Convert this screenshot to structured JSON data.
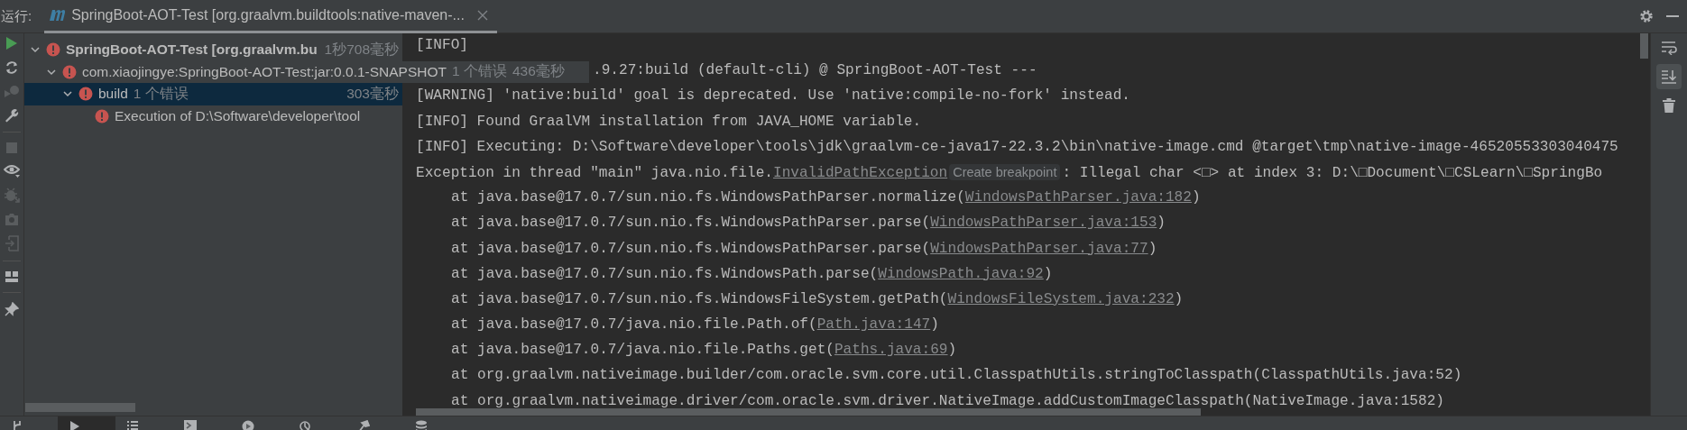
{
  "header": {
    "label": "运行:",
    "tab": {
      "title": "SpringBoot-AOT-Test [org.graalvm.buildtools:native-maven-...",
      "selected": true
    }
  },
  "tree": [
    {
      "name": "SpringBoot-AOT-Test [org.graalvm.bu",
      "bold": true,
      "time": "1秒708毫秒",
      "expanded": true,
      "selected": false,
      "children": [
        {
          "name": "com.xiaojingye:SpringBoot-AOT-Test:jar:0.0.1-SNAPSHOT",
          "bold": false,
          "errors": "1 个错误",
          "time": "436毫秒",
          "expanded": true,
          "selected": false,
          "children": [
            {
              "name": "build",
              "bold": false,
              "errors": "1 个错误",
              "time": "303毫秒",
              "expanded": true,
              "selected": true,
              "children": [
                {
                  "name": "Execution of D:\\Software\\developer\\tool",
                  "bold": false,
                  "selected": false
                }
              ]
            }
          ]
        }
      ]
    }
  ],
  "console": [
    {
      "kind": "message",
      "segments": [
        {
          "kind": "plain",
          "text": "[INFO]"
        }
      ]
    },
    {
      "kind": "continued",
      "segments": [
        {
          "kind": "plain",
          "text": ".9.27:build (default-cli) @ SpringBoot-AOT-Test ---"
        }
      ]
    },
    {
      "kind": "message",
      "segments": [
        {
          "kind": "plain",
          "text": "[WARNING] 'native:build' goal is deprecated. Use 'native:compile-no-fork' instead."
        }
      ]
    },
    {
      "kind": "message",
      "segments": [
        {
          "kind": "plain",
          "text": "[INFO] Found GraalVM installation from JAVA_HOME variable."
        }
      ]
    },
    {
      "kind": "message",
      "segments": [
        {
          "kind": "plain",
          "text": "[INFO] Executing: D:\\Software\\developer\\tools\\jdk\\graalvm-ce-java17-22.3.2\\bin\\native-image.cmd @target\\tmp\\native-image-46520553303040475"
        }
      ]
    },
    {
      "kind": "message",
      "segments": [
        {
          "kind": "plain",
          "text": "Exception in thread \"main\" java.nio.file."
        },
        {
          "kind": "link",
          "text": "InvalidPathException"
        },
        {
          "kind": "hint",
          "text": "Create breakpoint"
        },
        {
          "kind": "plain",
          "text": ": Illegal char <□> at index 3: D:\\□Document\\□CSLearn\\□SpringBo"
        }
      ]
    },
    {
      "kind": "frame",
      "segments": [
        {
          "kind": "plain",
          "text": "at java.base@17.0.7/sun.nio.fs.WindowsPathParser.normalize("
        },
        {
          "kind": "link",
          "text": "WindowsPathParser.java:182"
        },
        {
          "kind": "plain",
          "text": ")"
        }
      ]
    },
    {
      "kind": "frame",
      "segments": [
        {
          "kind": "plain",
          "text": "at java.base@17.0.7/sun.nio.fs.WindowsPathParser.parse("
        },
        {
          "kind": "link",
          "text": "WindowsPathParser.java:153"
        },
        {
          "kind": "plain",
          "text": ")"
        }
      ]
    },
    {
      "kind": "frame",
      "segments": [
        {
          "kind": "plain",
          "text": "at java.base@17.0.7/sun.nio.fs.WindowsPathParser.parse("
        },
        {
          "kind": "link",
          "text": "WindowsPathParser.java:77"
        },
        {
          "kind": "plain",
          "text": ")"
        }
      ]
    },
    {
      "kind": "frame",
      "segments": [
        {
          "kind": "plain",
          "text": "at java.base@17.0.7/sun.nio.fs.WindowsPath.parse("
        },
        {
          "kind": "link",
          "text": "WindowsPath.java:92"
        },
        {
          "kind": "plain",
          "text": ")"
        }
      ]
    },
    {
      "kind": "frame",
      "segments": [
        {
          "kind": "plain",
          "text": "at java.base@17.0.7/sun.nio.fs.WindowsFileSystem.getPath("
        },
        {
          "kind": "link",
          "text": "WindowsFileSystem.java:232"
        },
        {
          "kind": "plain",
          "text": ")"
        }
      ]
    },
    {
      "kind": "frame",
      "segments": [
        {
          "kind": "plain",
          "text": "at java.base@17.0.7/java.nio.file.Path.of("
        },
        {
          "kind": "link",
          "text": "Path.java:147"
        },
        {
          "kind": "plain",
          "text": ")"
        }
      ]
    },
    {
      "kind": "frame",
      "segments": [
        {
          "kind": "plain",
          "text": "at java.base@17.0.7/java.nio.file.Paths.get("
        },
        {
          "kind": "link",
          "text": "Paths.java:69"
        },
        {
          "kind": "plain",
          "text": ")"
        }
      ]
    },
    {
      "kind": "frame",
      "segments": [
        {
          "kind": "plain",
          "text": "at org.graalvm.nativeimage.builder/com.oracle.svm.core.util.ClasspathUtils.stringToClasspath(ClasspathUtils.java:52)"
        }
      ]
    },
    {
      "kind": "frame",
      "segments": [
        {
          "kind": "plain",
          "text": "at org.graalvm.nativeimage.driver/com.oracle.svm.driver.NativeImage.addCustomImageClasspath(NativeImage.java:1582)"
        }
      ]
    }
  ],
  "right_tools": [
    {
      "kind": "wrap",
      "selected": false
    },
    {
      "kind": "scroll-end",
      "selected": true
    },
    {
      "kind": "trash",
      "selected": false
    }
  ],
  "bottom_tabs": [
    {
      "kind": "git",
      "selected": false
    },
    {
      "kind": "run",
      "selected": true
    },
    {
      "kind": "list",
      "selected": false
    },
    {
      "kind": "terminal",
      "selected": false
    },
    {
      "kind": "services",
      "selected": false
    },
    {
      "kind": "profiler",
      "selected": false
    },
    {
      "kind": "build",
      "selected": false
    },
    {
      "kind": "database",
      "selected": false
    }
  ]
}
